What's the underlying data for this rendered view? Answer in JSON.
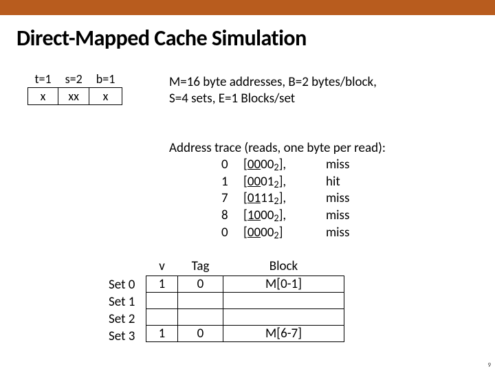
{
  "title": "Direct-Mapped Cache Simulation",
  "bitfield": {
    "headers": [
      "t=1",
      "s=2",
      "b=1"
    ],
    "cells": [
      "x",
      "xx",
      "x"
    ]
  },
  "params": {
    "line1": "M=16 byte addresses, B=2 bytes/block,",
    "line2": "S=4 sets, E=1 Blocks/set"
  },
  "trace": {
    "heading": "Address trace (reads, one byte per read):",
    "rows": [
      {
        "addr": "0",
        "bits_a": "00",
        "bits_b": "00",
        "bits_c": "2",
        "result": "miss"
      },
      {
        "addr": "1",
        "bits_a": "00",
        "bits_b": "01",
        "bits_c": "2",
        "result": "hit"
      },
      {
        "addr": "7",
        "bits_a": "01",
        "bits_b": "11",
        "bits_c": "2",
        "result": "miss"
      },
      {
        "addr": "8",
        "bits_a": "10",
        "bits_b": "00",
        "bits_c": "2",
        "result": "miss"
      },
      {
        "addr": "0",
        "bits_a": "00",
        "bits_b": "00",
        "bits_c": "2",
        "result": "miss"
      }
    ]
  },
  "cache": {
    "col_v": "v",
    "col_tag": "Tag",
    "col_blk": "Block",
    "rows": [
      {
        "label": "Set 0",
        "v": "1",
        "tag": "0",
        "block": "M[0-1]"
      },
      {
        "label": "Set 1",
        "v": "",
        "tag": "",
        "block": ""
      },
      {
        "label": "Set 2",
        "v": "",
        "tag": "",
        "block": ""
      },
      {
        "label": "Set 3",
        "v": "1",
        "tag": "0",
        "block": "M[6-7]"
      }
    ]
  },
  "pagenum": "9"
}
